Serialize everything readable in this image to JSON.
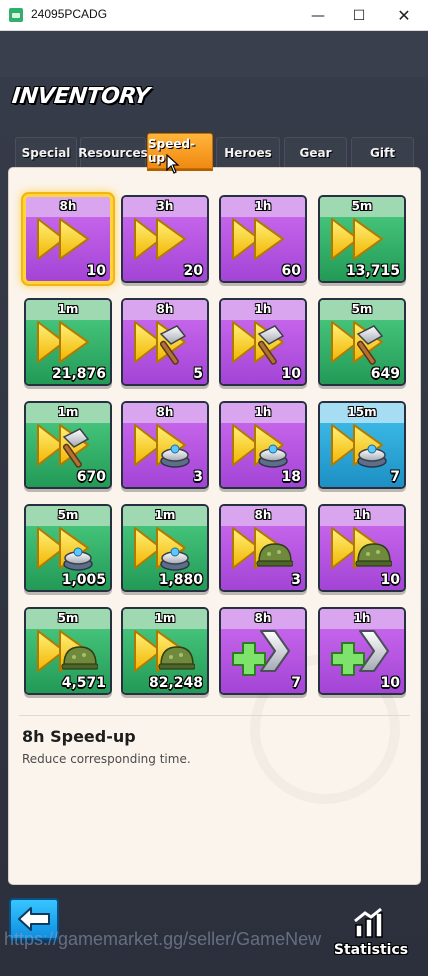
{
  "window": {
    "title": "24095PCADG",
    "minimize_glyph": "—",
    "maximize_glyph": "☐",
    "close_glyph": "✕"
  },
  "header": {
    "title": "INVENTORY"
  },
  "tabs": [
    {
      "label": "Special",
      "active": false
    },
    {
      "label": "Resources",
      "active": false
    },
    {
      "label": "Speed-up",
      "active": true
    },
    {
      "label": "Heroes",
      "active": false
    },
    {
      "label": "Gear",
      "active": false
    },
    {
      "label": "Gift",
      "active": false
    }
  ],
  "items": [
    {
      "duration": "8h",
      "quantity": "10",
      "color": "purple",
      "icon": "speedup-icon",
      "selected": true
    },
    {
      "duration": "3h",
      "quantity": "20",
      "color": "purple",
      "icon": "speedup-icon"
    },
    {
      "duration": "1h",
      "quantity": "60",
      "color": "purple",
      "icon": "speedup-icon"
    },
    {
      "duration": "5m",
      "quantity": "13,715",
      "color": "green",
      "icon": "speedup-icon"
    },
    {
      "duration": "1m",
      "quantity": "21,876",
      "color": "green",
      "icon": "speedup-icon"
    },
    {
      "duration": "8h",
      "quantity": "5",
      "color": "purple",
      "icon": "building-speedup-icon"
    },
    {
      "duration": "1h",
      "quantity": "10",
      "color": "purple",
      "icon": "building-speedup-icon"
    },
    {
      "duration": "5m",
      "quantity": "649",
      "color": "green",
      "icon": "building-speedup-icon"
    },
    {
      "duration": "1m",
      "quantity": "670",
      "color": "green",
      "icon": "building-speedup-icon"
    },
    {
      "duration": "8h",
      "quantity": "3",
      "color": "purple",
      "icon": "research-speedup-icon"
    },
    {
      "duration": "1h",
      "quantity": "18",
      "color": "purple",
      "icon": "research-speedup-icon"
    },
    {
      "duration": "15m",
      "quantity": "7",
      "color": "blue",
      "icon": "research-speedup-icon"
    },
    {
      "duration": "5m",
      "quantity": "1,005",
      "color": "green",
      "icon": "research-speedup-icon"
    },
    {
      "duration": "1m",
      "quantity": "1,880",
      "color": "green",
      "icon": "research-speedup-icon"
    },
    {
      "duration": "8h",
      "quantity": "3",
      "color": "purple",
      "icon": "training-speedup-icon"
    },
    {
      "duration": "1h",
      "quantity": "10",
      "color": "purple",
      "icon": "training-speedup-icon"
    },
    {
      "duration": "5m",
      "quantity": "4,571",
      "color": "green",
      "icon": "training-speedup-icon"
    },
    {
      "duration": "1m",
      "quantity": "82,248",
      "color": "green",
      "icon": "training-speedup-icon"
    },
    {
      "duration": "8h",
      "quantity": "7",
      "color": "purple",
      "icon": "healing-speedup-icon"
    },
    {
      "duration": "1h",
      "quantity": "10",
      "color": "purple",
      "icon": "healing-speedup-icon"
    }
  ],
  "detail": {
    "title": "8h Speed-up",
    "description": "Reduce corresponding time."
  },
  "footer": {
    "back_icon": "back-arrow-icon",
    "stats_icon": "statistics-icon",
    "stats_label": "Statistics",
    "watermark": "https://gamemarket.gg/seller/GameNew"
  }
}
